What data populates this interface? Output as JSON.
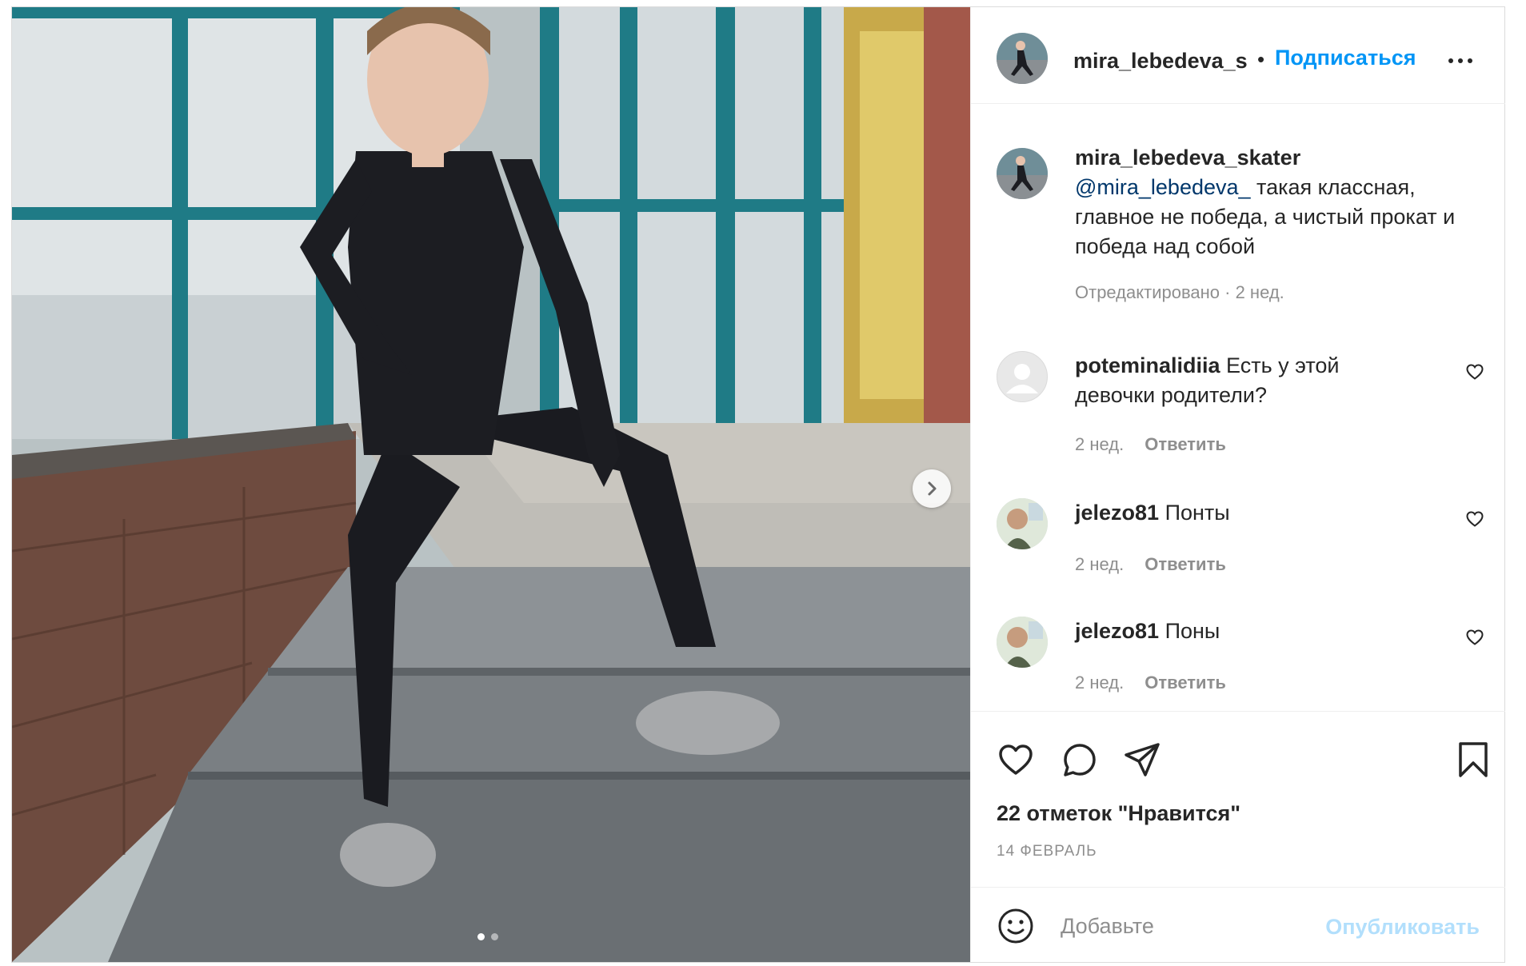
{
  "post": {
    "media": {
      "slide_count": 2,
      "active_slide": 1,
      "next_icon": "chevron-right-icon"
    },
    "header": {
      "username": "mira_lebedeva_s",
      "separator": "•",
      "follow_label": "Подписаться",
      "more_icon": "more-horizontal-icon"
    },
    "caption": {
      "username": "mira_lebedeva_skater",
      "mention": "@mira_lebedeva_",
      "text": " такая классная, главное не победа, а чистый прокат и победа над собой",
      "meta": "Отредактировано · 2 нед."
    },
    "comments": [
      {
        "username": "poteminalidiia",
        "text": " Есть у этой девочки родители?",
        "time": "2 нед.",
        "reply_label": "Ответить"
      },
      {
        "username": "jelezo81",
        "text": " Понты",
        "time": "2 нед.",
        "reply_label": "Ответить"
      },
      {
        "username": "jelezo81",
        "text": " Поны",
        "time": "2 нед.",
        "reply_label": "Ответить"
      }
    ],
    "actions": {
      "like_icon": "heart-icon",
      "comment_icon": "comment-bubble-icon",
      "share_icon": "paper-plane-icon",
      "save_icon": "bookmark-icon"
    },
    "likes_text": "22 отметок \"Нравится\"",
    "date": "14 ФЕВРАЛЬ",
    "add_comment": {
      "emoji_icon": "smiley-icon",
      "placeholder": "Добавьте",
      "publish_label": "Опубликовать"
    },
    "colors": {
      "accent": "#0095f6",
      "publish_disabled": "#b2dffc",
      "text": "#262626",
      "muted": "#8e8e8e",
      "mention": "#00376b"
    }
  }
}
